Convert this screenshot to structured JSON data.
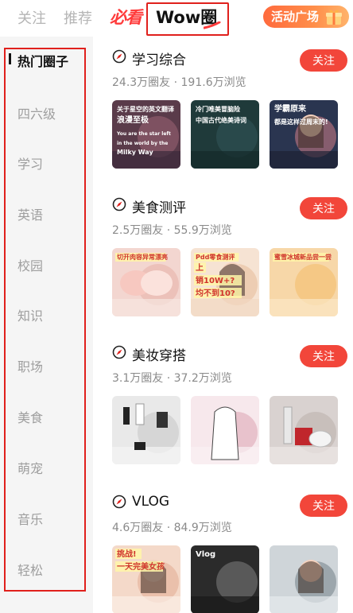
{
  "topbar": {
    "tab_follow": "关注",
    "tab_recommend": "推荐",
    "tab_bixiu": "必看",
    "tab_wow": "Wow圈",
    "activity_label": "活动广场"
  },
  "sidebar": {
    "items": [
      {
        "label": "热门圈子",
        "active": true
      },
      {
        "label": "四六级"
      },
      {
        "label": "学习"
      },
      {
        "label": "英语"
      },
      {
        "label": "校园"
      },
      {
        "label": "知识"
      },
      {
        "label": "职场"
      },
      {
        "label": "美食"
      },
      {
        "label": "萌宠"
      },
      {
        "label": "音乐"
      },
      {
        "label": "轻松"
      }
    ]
  },
  "sections": [
    {
      "title": "学习综合",
      "stats": "24.3万圈友 · 191.6万浏览",
      "follow_label": "关注",
      "thumbs": [
        {
          "lines": [
            "关于星空的英文翻译",
            "浪漫至极",
            "You are the star left",
            "in the world by the",
            "Milky Way"
          ]
        },
        {
          "lines": [
            "冷门唯美冒脑险",
            "中国古代绝美诗词"
          ]
        },
        {
          "lines": [
            "学霸原来",
            "都是这样过周末的!"
          ]
        }
      ]
    },
    {
      "title": "美食测评",
      "stats": "2.5万圈友 · 55.9万浏览",
      "follow_label": "关注",
      "thumbs": [
        {
          "lines": [
            "切开肉容异常漂亮"
          ]
        },
        {
          "lines": [
            "Pdd零食测评",
            "上",
            "销10W+?",
            "均不到10?"
          ]
        },
        {
          "lines": [
            "蜜雪冰城新品尝一尝"
          ]
        }
      ]
    },
    {
      "title": "美妆穿搭",
      "stats": "3.1万圈友 · 37.2万浏览",
      "follow_label": "关注",
      "thumbs": [
        {
          "lines": []
        },
        {
          "lines": []
        },
        {
          "lines": []
        }
      ]
    },
    {
      "title": "VLOG",
      "stats": "4.6万圈友 · 84.9万浏览",
      "follow_label": "关注",
      "thumbs": [
        {
          "lines": [
            "挑战!",
            "一天完美女孩"
          ]
        },
        {
          "lines": [
            "Vlog"
          ]
        },
        {
          "lines": []
        }
      ]
    }
  ],
  "colors": {
    "accent": "#f2463a",
    "highlight_outline": "#e0201c",
    "sidebar_bg": "#f5f5f5"
  }
}
